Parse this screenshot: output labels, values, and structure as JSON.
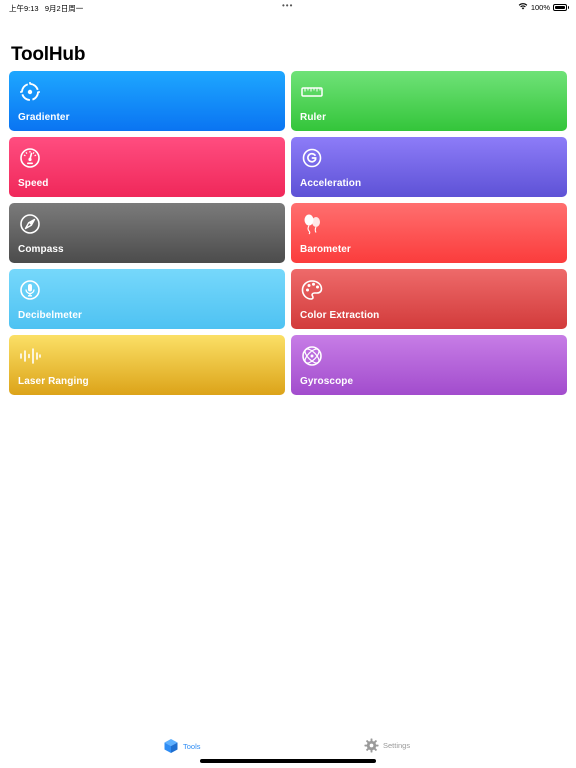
{
  "status_bar": {
    "time": "上午9:13",
    "date": "9月2日周一",
    "more": "•••",
    "battery_text": "100%",
    "battery_level": 1.0,
    "wifi_icon": "wifi-icon"
  },
  "page": {
    "title": "ToolHub"
  },
  "tools": [
    {
      "label": "Gradienter",
      "icon": "target-icon",
      "gradient": [
        "#1ea7ff",
        "#0a74f2"
      ]
    },
    {
      "label": "Ruler",
      "icon": "ruler-icon",
      "gradient": [
        "#6fe278",
        "#34c53a"
      ]
    },
    {
      "label": "Speed",
      "icon": "speedometer-icon",
      "gradient": [
        "#ff4d80",
        "#f0285a"
      ]
    },
    {
      "label": "Acceleration",
      "icon": "g-force-icon",
      "gradient": [
        "#8d7cf8",
        "#5e52d6"
      ]
    },
    {
      "label": "Compass",
      "icon": "compass-icon",
      "gradient": [
        "#7b7b7b",
        "#4c4c4c"
      ]
    },
    {
      "label": "Barometer",
      "icon": "balloons-icon",
      "gradient": [
        "#ff6f6f",
        "#fb3c3c"
      ]
    },
    {
      "label": "Decibelmeter",
      "icon": "microphone-icon",
      "gradient": [
        "#76d8fb",
        "#4ec2f2"
      ]
    },
    {
      "label": "Color Extraction",
      "icon": "palette-icon",
      "gradient": [
        "#ee6a6a",
        "#d23b3b"
      ]
    },
    {
      "label": "Laser Ranging",
      "icon": "waveform-icon",
      "gradient": [
        "#fbe066",
        "#dca319"
      ]
    },
    {
      "label": "Gyroscope",
      "icon": "gyroscope-icon",
      "gradient": [
        "#c77de6",
        "#a24ccd"
      ]
    }
  ],
  "tabbar": {
    "tools_label": "Tools",
    "tools_icon": "cube-icon",
    "settings_label": "Settings",
    "settings_icon": "gear-icon",
    "active_color": "#2f8df4",
    "inactive_color": "#9a9a9a"
  }
}
